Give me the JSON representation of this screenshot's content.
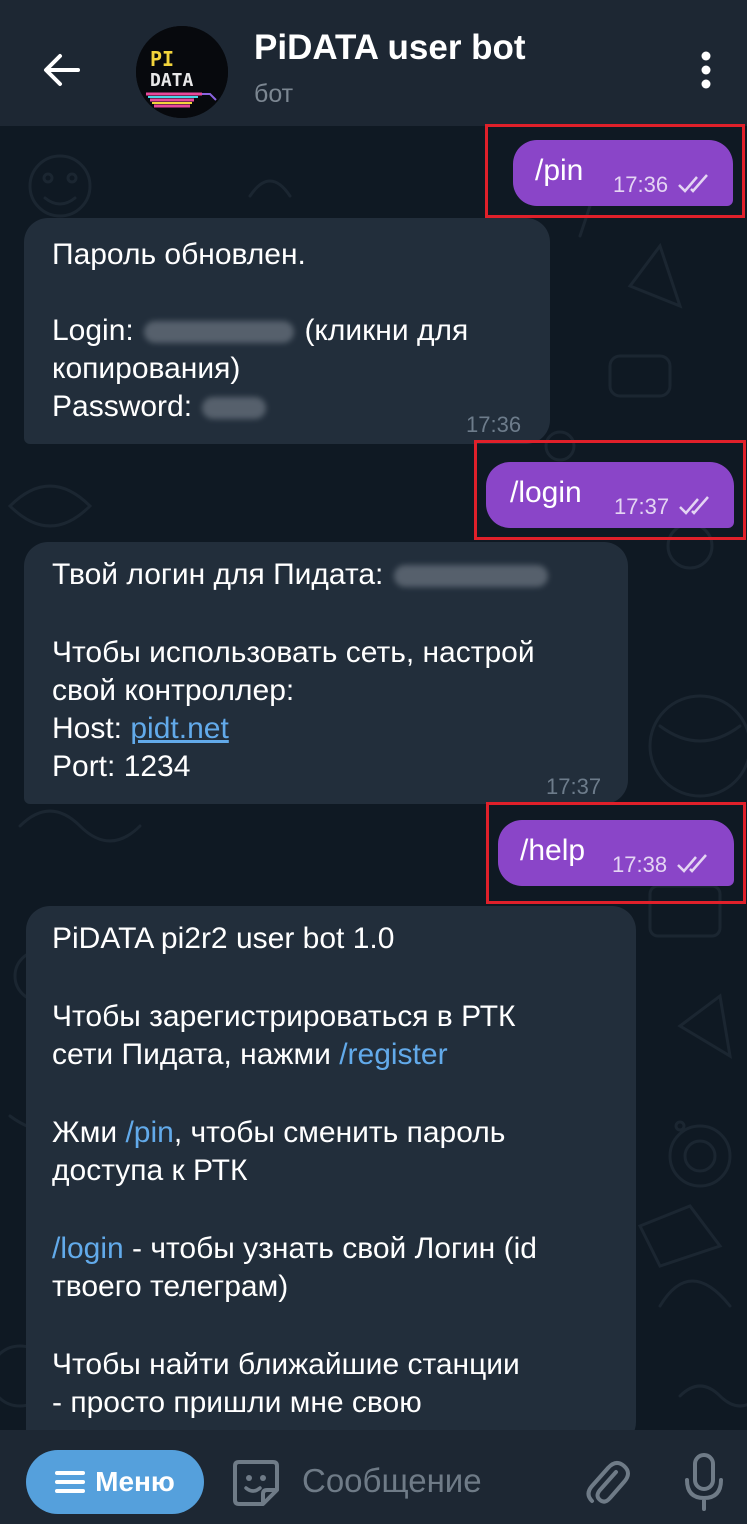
{
  "header": {
    "title": "PiDATA user bot",
    "subtitle": "бот",
    "avatar_text_top": "PI",
    "avatar_text_bottom": "DATA",
    "back_icon": "arrow-left-icon",
    "more_icon": "more-vertical-icon"
  },
  "messages": [
    {
      "kind": "out",
      "text": "/pin",
      "time": "17:36",
      "status": "read"
    },
    {
      "kind": "in",
      "line1": "Пароль обновлен.",
      "login_label": "Login:",
      "login_note": "(кликни для",
      "login_note2": "копирования)",
      "password_label": "Password:",
      "time": "17:36"
    },
    {
      "kind": "out",
      "text": "/login",
      "time": "17:37",
      "status": "read"
    },
    {
      "kind": "in",
      "line1": "Твой логин для Пидата:",
      "line2": "Чтобы использовать сеть, настрой",
      "line3": "свой контроллер:",
      "host_label": "Host:",
      "host_link": "pidt.net",
      "port": "Port: 1234",
      "time": "17:37"
    },
    {
      "kind": "out",
      "text": "/help",
      "time": "17:38",
      "status": "read"
    },
    {
      "kind": "in",
      "p1": "PiDATA pi2r2 user bot 1.0",
      "p2a": "Чтобы зарегистрироваться в РТК",
      "p2b": "сети Пидата, нажми",
      "p2cmd": "/register",
      "p3a_pre": "Жми",
      "p3cmd": "/pin",
      "p3a_post": ", чтобы сменить пароль",
      "p3b": "доступа к РТК",
      "p4cmd": "/login",
      "p4a_post": " - чтобы узнать свой Логин (id",
      "p4b": "твоего телеграм)",
      "p5a": "Чтобы найти ближайшие станции",
      "p5b": "- просто пришли мне свою"
    }
  ],
  "input": {
    "menu_label": "Меню",
    "placeholder": "Сообщение",
    "menu_icon": "hamburger-icon",
    "sticker_icon": "sticker-icon",
    "attach_icon": "paperclip-icon",
    "mic_icon": "microphone-icon"
  },
  "colors": {
    "outgoing_bubble": "#8a45c8",
    "incoming_bubble": "#222e3b",
    "header": "#1d2733",
    "link": "#62aaea",
    "highlight": "#e0202a"
  }
}
